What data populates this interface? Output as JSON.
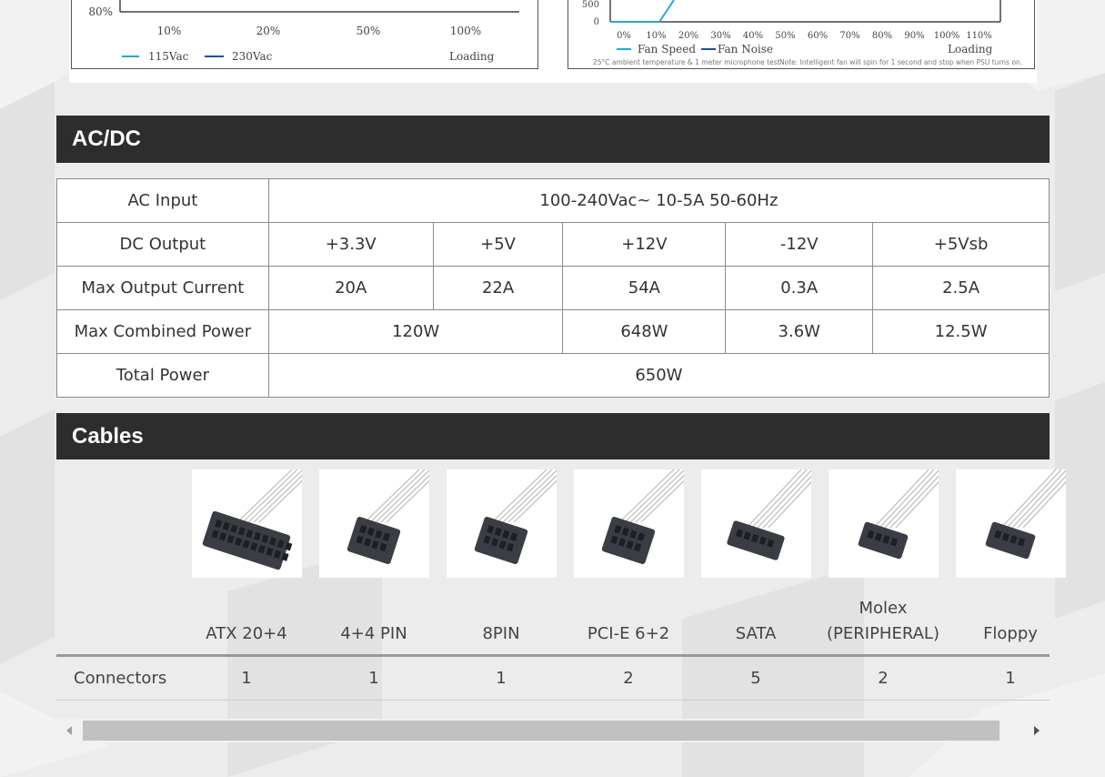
{
  "charts": {
    "efficiency": {
      "ytick": "80%",
      "xticks": [
        "10%",
        "20%",
        "50%",
        "100%"
      ],
      "legend": [
        "115Vac",
        "230Vac"
      ],
      "xlabel": "Loading",
      "colors": [
        "#2aa3e0",
        "#1f4f9a"
      ]
    },
    "fan": {
      "yticks": [
        "500",
        "0"
      ],
      "xticks": [
        "0%",
        "10%",
        "20%",
        "30%",
        "40%",
        "50%",
        "60%",
        "70%",
        "80%",
        "90%",
        "100%",
        "110%"
      ],
      "legend": [
        "Fan Speed",
        "Fan Noise"
      ],
      "xlabel": "Loading",
      "note_left": "25°C ambient temperature & 1 meter microphone test",
      "note_right": "Note: Intelligent fan will spin for 1 second and stop when PSU turns on.",
      "colors": [
        "#2aa3e0",
        "#1f4f9a"
      ]
    }
  },
  "acdc": {
    "title": "AC/DC",
    "ac_input_label": "AC Input",
    "ac_input_value": "100-240Vac~  10-5A  50-60Hz",
    "dc_output_label": "DC Output",
    "rails": [
      "+3.3V",
      "+5V",
      "+12V",
      "-12V",
      "+5Vsb"
    ],
    "max_current_label": "Max Output Current",
    "max_current": [
      "20A",
      "22A",
      "54A",
      "0.3A",
      "2.5A"
    ],
    "combined_label": "Max Combined Power",
    "combined": [
      "120W",
      "648W",
      "3.6W",
      "12.5W"
    ],
    "total_label": "Total Power",
    "total_value": "650W"
  },
  "cables": {
    "title": "Cables",
    "names": [
      {
        "line1": "",
        "line2": "ATX 20+4"
      },
      {
        "line1": "",
        "line2": "4+4 PIN"
      },
      {
        "line1": "",
        "line2": "8PIN"
      },
      {
        "line1": "",
        "line2": "PCI-E 6+2"
      },
      {
        "line1": "",
        "line2": "SATA"
      },
      {
        "line1": "Molex",
        "line2": "(PERIPHERAL)"
      },
      {
        "line1": "",
        "line2": "Floppy"
      }
    ],
    "connectors_label": "Connectors",
    "connectors": [
      "1",
      "1",
      "1",
      "2",
      "5",
      "2",
      "1"
    ]
  },
  "colors": {
    "header_bg": "#2d2d2d",
    "header_text": "#ffffff",
    "scroll_thumb": "#c1c1c1"
  }
}
